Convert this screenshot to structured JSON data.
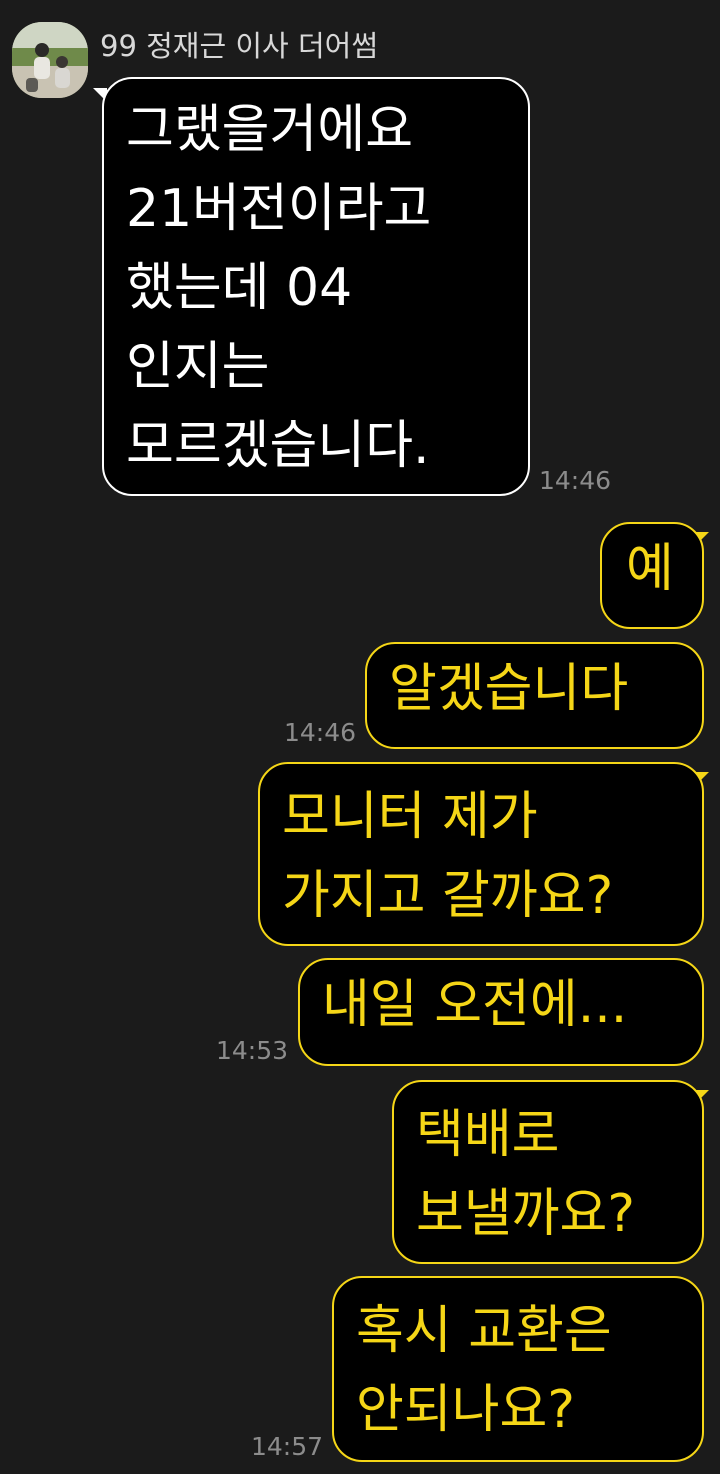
{
  "chat": {
    "sender_name": "99 정재근 이사 더어썸",
    "messages": [
      {
        "text": "그랬을거에요\n21버전이라고\n했는데  04\n인지는\n모르겠습니다."
      },
      {
        "text": "예"
      },
      {
        "text": "알겠습니다"
      },
      {
        "text": "모니터 제가\n가지고 갈까요?"
      },
      {
        "text": "내일 오전에..."
      },
      {
        "text": "택배로\n보낼까요?"
      },
      {
        "text": "혹시 교환은\n안되나요?"
      }
    ],
    "times": [
      "14:46",
      "14:46",
      "14:53",
      "14:57"
    ]
  },
  "colors": {
    "background": "#1b1b1b",
    "incoming_border": "#ffffff",
    "outgoing_border": "#f5d617",
    "timestamp": "#8c8c8c"
  }
}
